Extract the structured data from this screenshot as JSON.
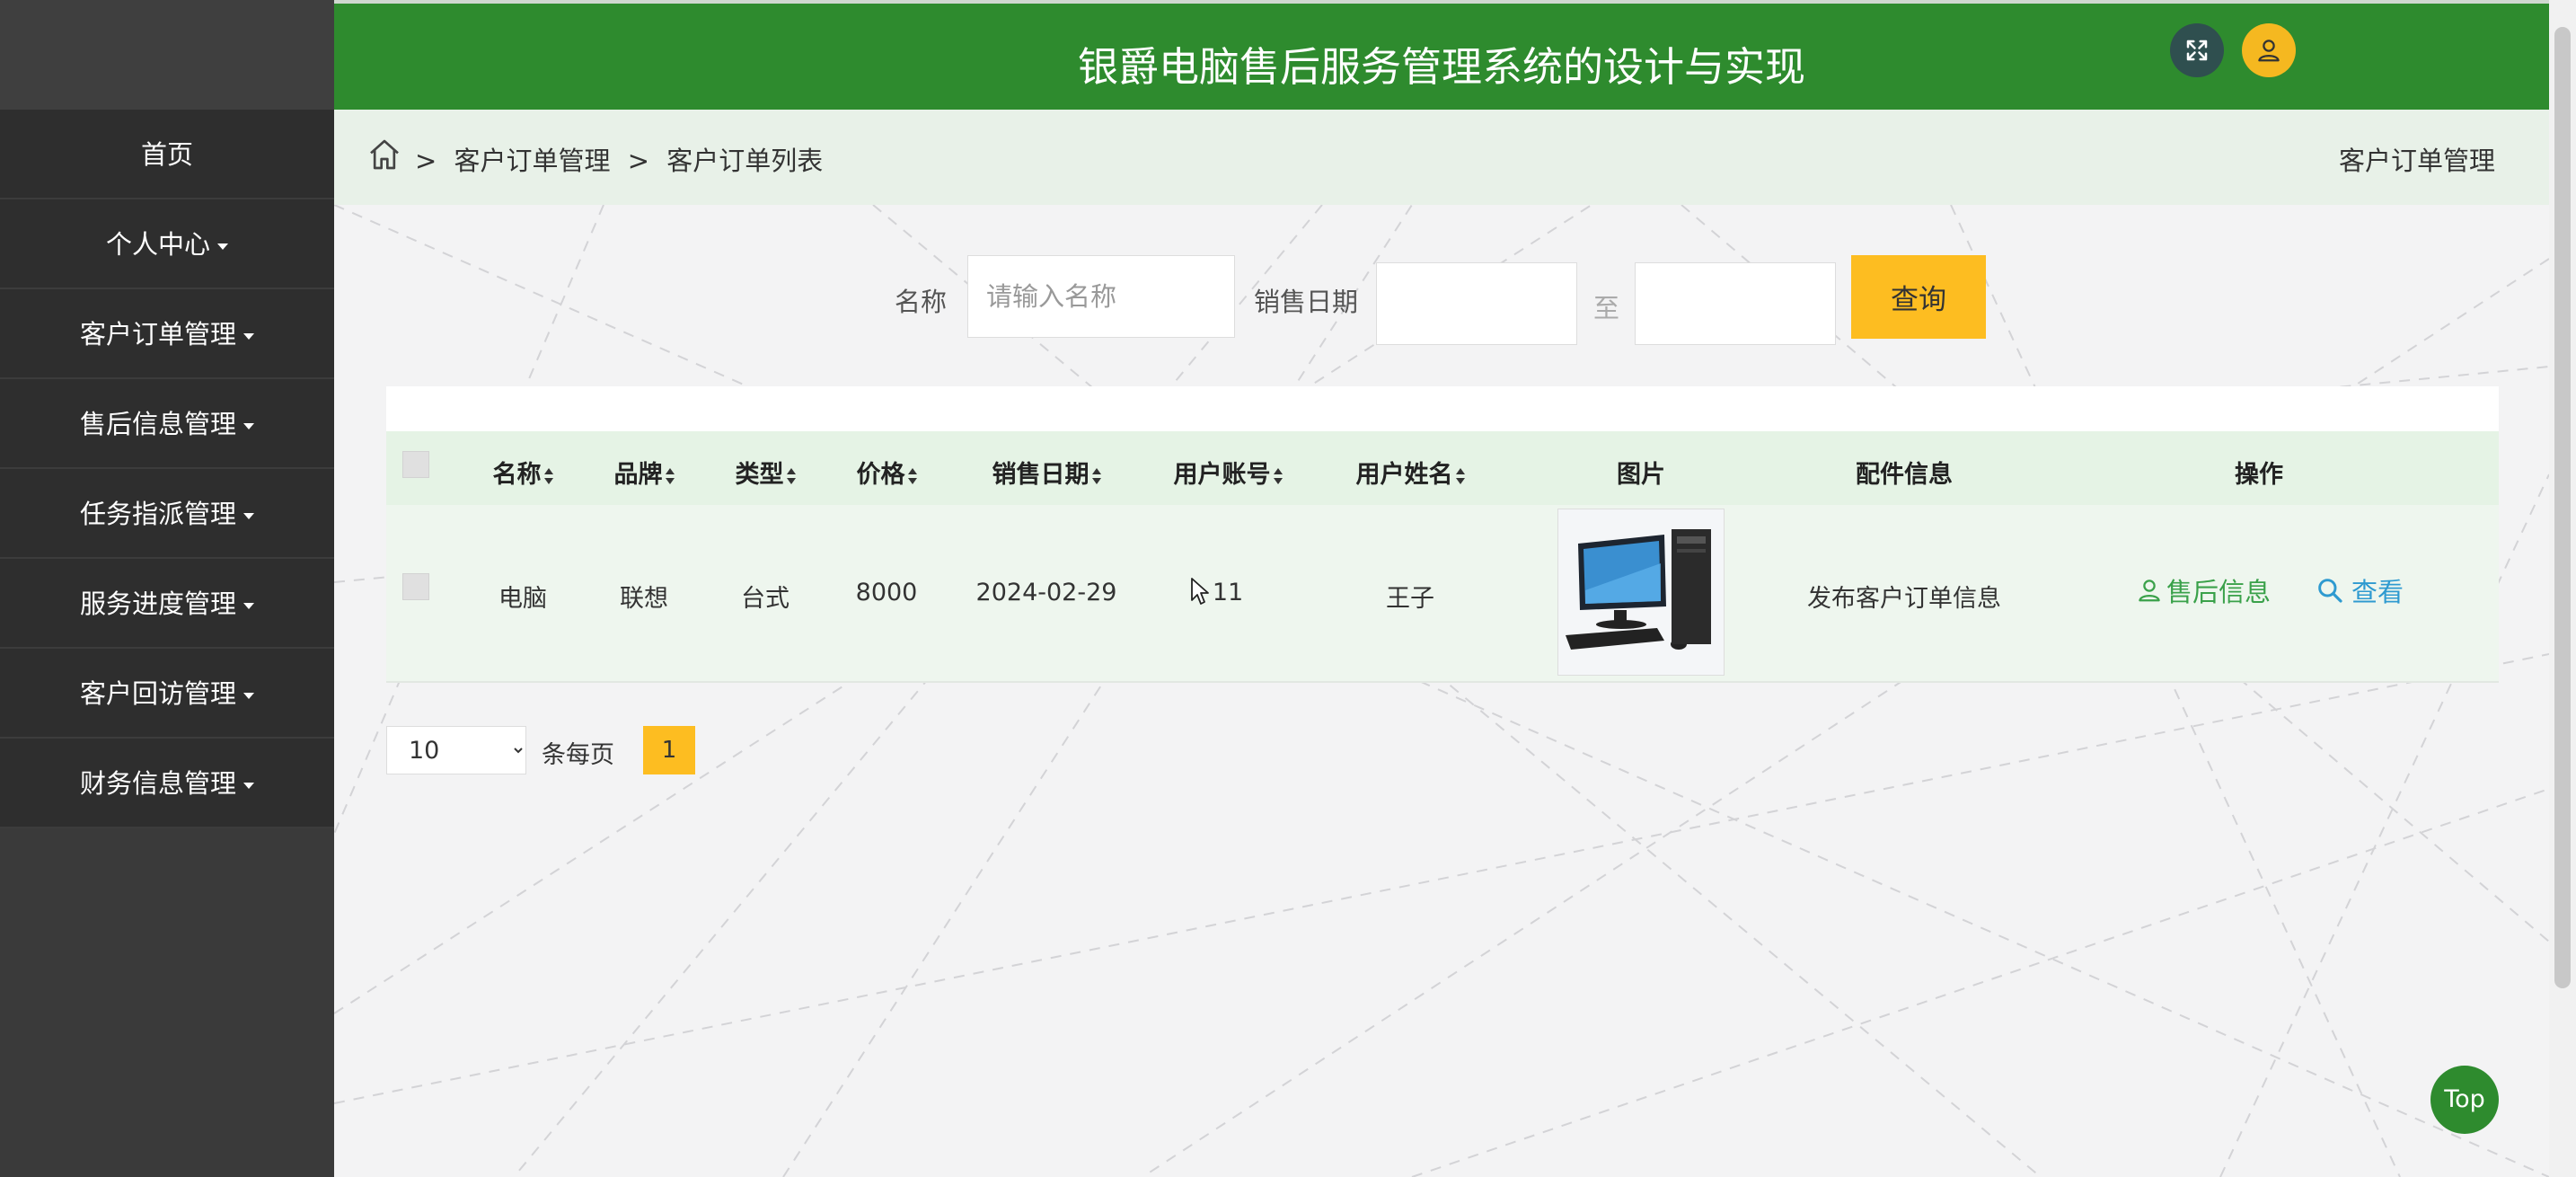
{
  "app": {
    "title": "银爵电脑售后服务管理系统的设计与实现"
  },
  "sidebar": {
    "items": [
      {
        "label": "首页",
        "has_caret": false
      },
      {
        "label": "个人中心",
        "has_caret": true
      },
      {
        "label": "客户订单管理",
        "has_caret": true
      },
      {
        "label": "售后信息管理",
        "has_caret": true
      },
      {
        "label": "任务指派管理",
        "has_caret": true
      },
      {
        "label": "服务进度管理",
        "has_caret": true
      },
      {
        "label": "客户回访管理",
        "has_caret": true
      },
      {
        "label": "财务信息管理",
        "has_caret": true
      }
    ]
  },
  "breadcrumb": {
    "sep": ">",
    "items": [
      "客户订单管理",
      "客户订单列表"
    ],
    "right": "客户订单管理"
  },
  "search": {
    "name_label": "名称",
    "name_placeholder": "请输入名称",
    "date_label": "销售日期",
    "to_label": "至",
    "query_button": "查询"
  },
  "table": {
    "headers": [
      "名称",
      "品牌",
      "类型",
      "价格",
      "销售日期",
      "用户账号",
      "用户姓名",
      "图片",
      "配件信息",
      "操作"
    ],
    "rows": [
      {
        "name": "电脑",
        "brand": "联想",
        "type": "台式",
        "price": "8000",
        "date": "2024-02-29",
        "account": "11",
        "username": "王子",
        "parts": "发布客户订单信息",
        "op_service": "售后信息",
        "op_view": "查看"
      }
    ]
  },
  "pagination": {
    "page_size": "10",
    "page_size_options": [
      "10"
    ],
    "per_page_label": "条每页",
    "current_page": "1"
  },
  "top_button": "Top",
  "colors": {
    "header_green": "#2e8b2e",
    "accent_yellow": "#fdbd21",
    "sidebar_dark": "#2e2e2e",
    "link_blue": "#2e9ad0",
    "link_green": "#3aa14a"
  }
}
